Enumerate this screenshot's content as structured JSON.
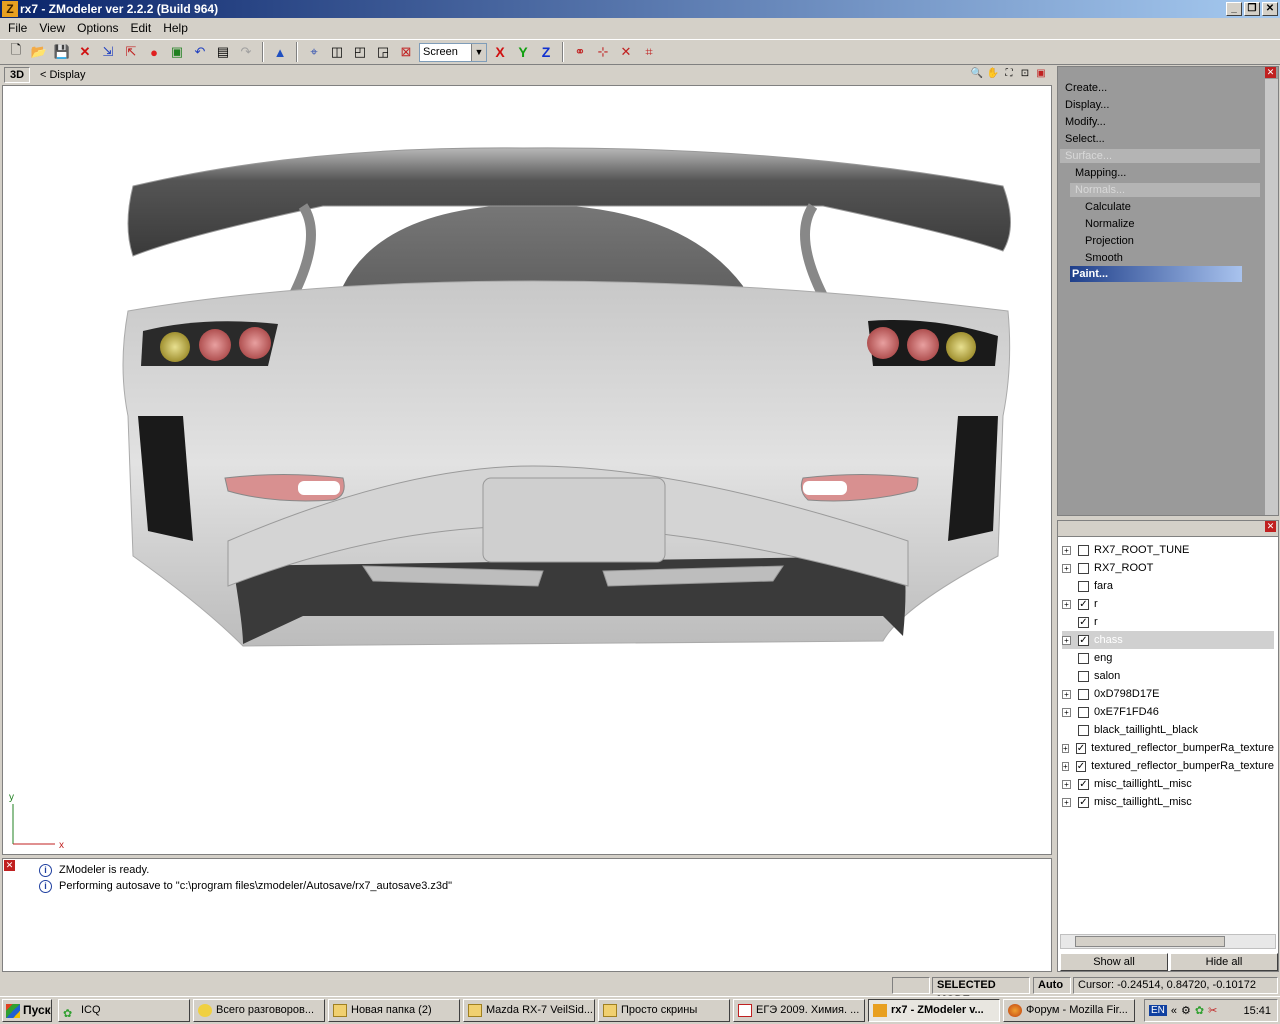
{
  "window": {
    "title": "rx7 - ZModeler ver 2.2.2 (Build 964)",
    "icon": "Z"
  },
  "menu": [
    "File",
    "View",
    "Options",
    "Edit",
    "Help"
  ],
  "toolbar": {
    "view_mode": "Screen",
    "axes": [
      "X",
      "Y",
      "Z"
    ]
  },
  "viewport": {
    "mode": "3D",
    "label": "< Display",
    "axis_y": "y",
    "axis_x": "x"
  },
  "commands": {
    "create": "Create...",
    "display": "Display...",
    "modify": "Modify...",
    "select": "Select...",
    "surface": "Surface...",
    "mapping": "Mapping...",
    "normals": "Normals...",
    "calculate": "Calculate",
    "normalize": "Normalize",
    "projection": "Projection",
    "smooth": "Smooth",
    "paint": "Paint..."
  },
  "tree": [
    {
      "label": "RX7_ROOT_TUNE",
      "expandable": true,
      "checked": false
    },
    {
      "label": "RX7_ROOT",
      "expandable": true,
      "checked": false
    },
    {
      "label": "fara",
      "expandable": false,
      "checked": false
    },
    {
      "label": "r",
      "expandable": true,
      "checked": true
    },
    {
      "label": "r",
      "expandable": false,
      "checked": true
    },
    {
      "label": "chass",
      "expandable": true,
      "checked": true,
      "selected": true
    },
    {
      "label": "eng",
      "expandable": false,
      "checked": false
    },
    {
      "label": "salon",
      "expandable": false,
      "checked": false
    },
    {
      "label": "0xD798D17E",
      "expandable": true,
      "checked": false
    },
    {
      "label": "0xE7F1FD46",
      "expandable": true,
      "checked": false
    },
    {
      "label": "black_taillightL_black",
      "expandable": false,
      "checked": false
    },
    {
      "label": "textured_reflector_bumperRa_texture",
      "expandable": true,
      "checked": true
    },
    {
      "label": "textured_reflector_bumperRa_texture",
      "expandable": true,
      "checked": true
    },
    {
      "label": "misc_taillightL_misc",
      "expandable": true,
      "checked": true
    },
    {
      "label": "misc_taillightL_misc",
      "expandable": true,
      "checked": true
    }
  ],
  "tree_buttons": {
    "show": "Show all",
    "hide": "Hide all"
  },
  "log": [
    "ZModeler is ready.",
    "Performing autosave to \"c:\\program files\\zmodeler/Autosave/rx7_autosave3.z3d\""
  ],
  "status": {
    "mode": "SELECTED MODE",
    "auto": "Auto",
    "cursor": "Cursor: -0.24514, 0.84720, -0.10172"
  },
  "taskbar": {
    "start": "Пуск",
    "tasks": [
      "ICQ",
      "Всего разговоров...",
      "Новая папка (2)",
      "Mazda RX-7 VeilSid...",
      "Просто скрины",
      "ЕГЭ 2009. Химия. ...",
      "rx7 - ZModeler v...",
      "Форум - Mozilla Fir..."
    ],
    "lang": "EN",
    "clock": "15:41"
  }
}
